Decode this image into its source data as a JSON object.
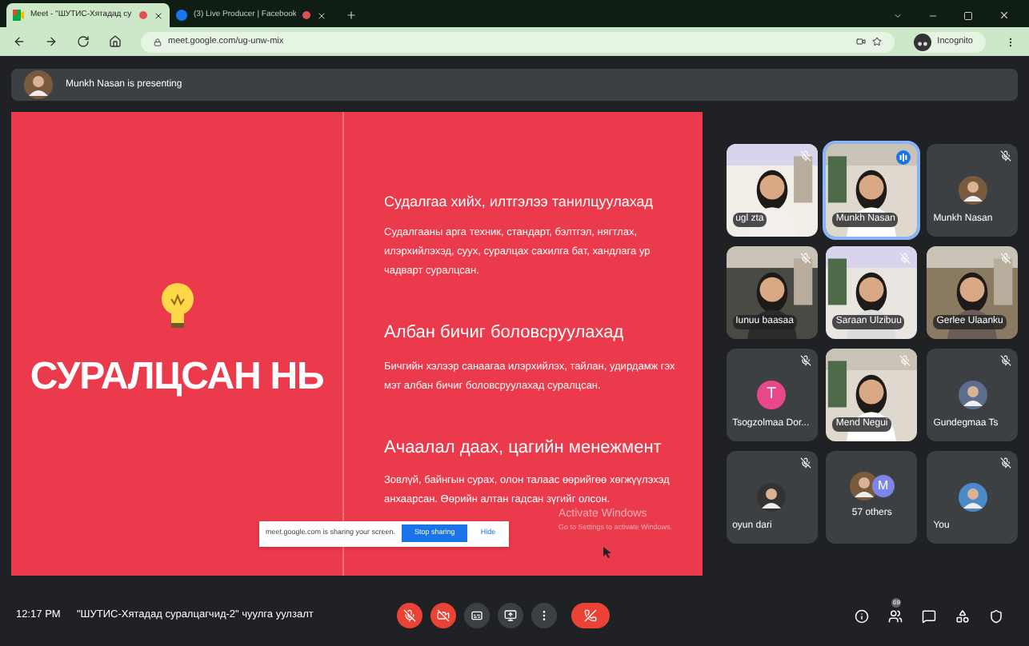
{
  "browser": {
    "tabs": [
      {
        "kind": "meet",
        "title": "Meet - \"ШУТИС-Хятадад су",
        "selected": true
      },
      {
        "kind": "facebook",
        "title": "(3) Live Producer | Facebook",
        "selected": false
      }
    ],
    "url": "meet.google.com/ug-unw-mix",
    "profile": "Incognito"
  },
  "banner": {
    "text": "Munkh Nasan is presenting"
  },
  "slide": {
    "title": "СУРАЛЦСАН НЬ",
    "sections": [
      {
        "heading": "Судалгаа хийх, илтгэлээ танилцуулахад",
        "body": "Судалгааны арга техник, стандарт, бэлтгэл, нягтлах, илэрхийлэхэд, сууx, суралцах сахилга бат, хандлага ур чадварт суралцсан."
      },
      {
        "heading": "Албан бичиг боловсруулахад",
        "body": "Бичгийн хэлээр санаагаа илэрхийлэх, тайлан, удирдамж гэх мэт албан бичиг боловсруулахад суралцсан."
      },
      {
        "heading": "Ачаалал даах, цагийн менежмент",
        "body": "Зовлүй, байнгын сурах, олон талаас өөрийгөө хөгжүүлэхэд анхаарсан. Өөрийн алтан гадсан зүгийг олсон."
      }
    ]
  },
  "share_bar": {
    "text": "meet.google.com is sharing your screen.",
    "stop": "Stop sharing",
    "hide": "Hide"
  },
  "activation": {
    "title": "Activate Windows",
    "subtitle": "Go to Settings to activate Windows."
  },
  "tiles": [
    {
      "kind": "video",
      "name": "ugl zta",
      "muted": true,
      "speaking": false
    },
    {
      "kind": "video",
      "name": "Munkh Nasan",
      "muted": false,
      "speaking": true
    },
    {
      "kind": "avatar",
      "name": "Munkh Nasan",
      "muted": true,
      "speaking": false
    },
    {
      "kind": "video",
      "name": "Iunuu baasaa",
      "muted": true,
      "speaking": false
    },
    {
      "kind": "video",
      "name": "Saraan Ulzibuu",
      "muted": true,
      "speaking": false
    },
    {
      "kind": "video",
      "name": "Gerlee Ulaanku",
      "muted": true,
      "speaking": false
    },
    {
      "kind": "initial",
      "name": "Tsogzolmaa Dor...",
      "initial": "T",
      "color": "#e8488a",
      "muted": true,
      "speaking": false
    },
    {
      "kind": "video",
      "name": "Mend Negui",
      "muted": true,
      "speaking": false
    },
    {
      "kind": "avatar",
      "name": "Gundegmaa Ts",
      "muted": true,
      "speaking": false
    },
    {
      "kind": "avatar",
      "name": "oyun dari",
      "muted": true,
      "speaking": false
    },
    {
      "kind": "others",
      "name": "57 others",
      "initial": "M",
      "color": "#7b86e8",
      "muted": false,
      "speaking": false
    },
    {
      "kind": "avatar",
      "name": "You",
      "muted": true,
      "speaking": false
    }
  ],
  "bottom": {
    "time": "12:17 PM",
    "meeting": "\"ШУТИС-Хятадад суралцагчид-2\" чуулга уулзалт",
    "people_count": "69",
    "controls": [
      {
        "kind": "mic",
        "on": false
      },
      {
        "kind": "camera",
        "on": false
      },
      {
        "kind": "captions"
      },
      {
        "kind": "present"
      },
      {
        "kind": "more"
      },
      {
        "kind": "leave"
      }
    ]
  }
}
